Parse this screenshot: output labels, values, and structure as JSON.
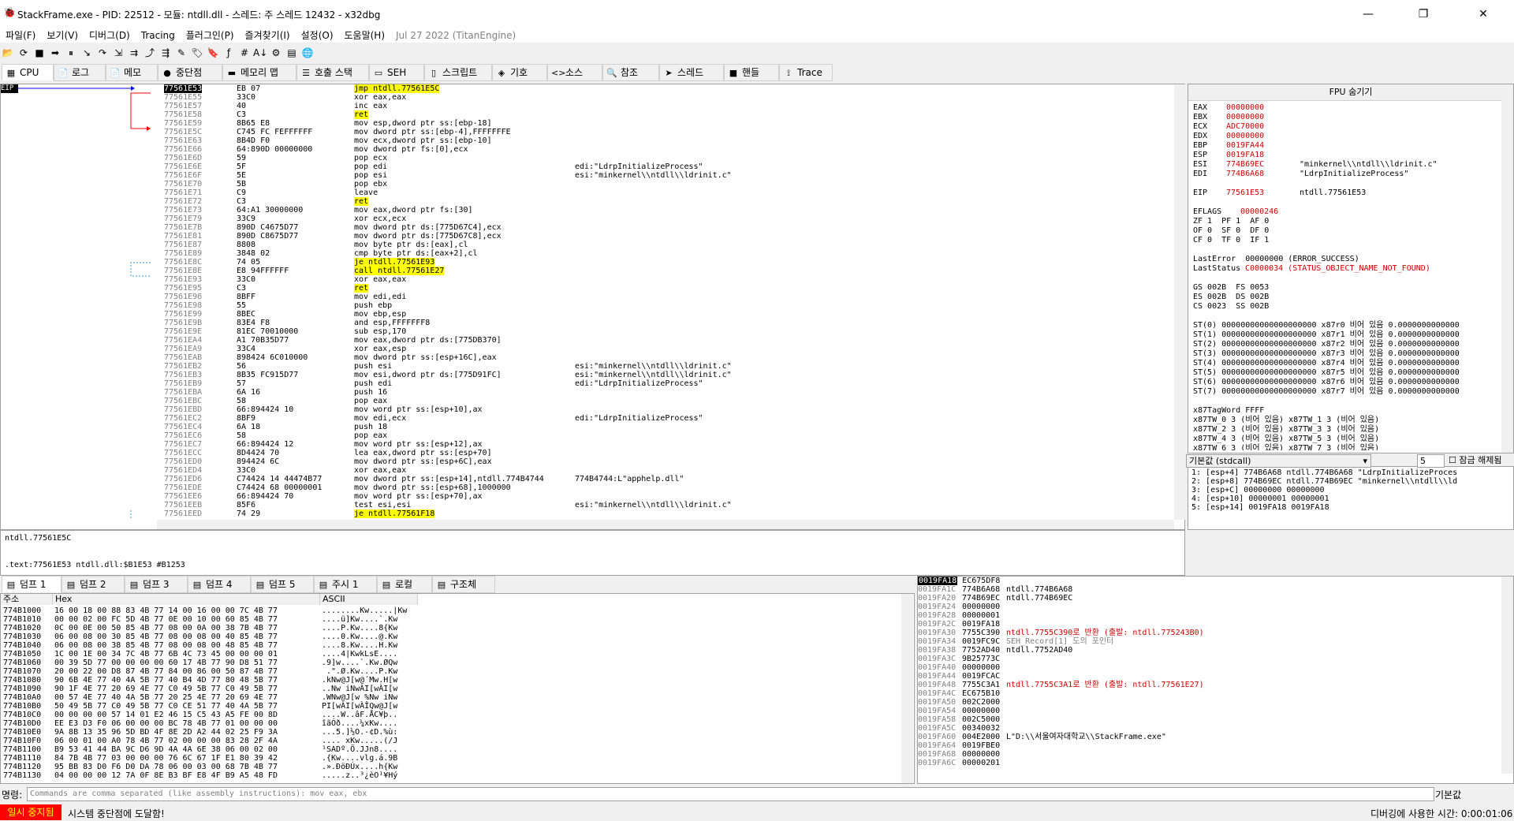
{
  "window": {
    "title": "StackFrame.exe - PID: 22512 - 모듈: ntdll.dll - 스레드: 주 스레드 12432 - x32dbg",
    "minimize": "—",
    "maximize": "❐",
    "close": "✕"
  },
  "menu": [
    "파일(F)",
    "보기(V)",
    "디버그(D)",
    "Tracing",
    "플러그인(P)",
    "즐겨찾기(I)",
    "설정(O)",
    "도움말(H)"
  ],
  "build_date": "Jul 27 2022 (TitanEngine)",
  "toolbar_icons": [
    "open-icon",
    "restart-icon",
    "stop-icon",
    "run-icon",
    "pause-icon",
    "step-into-icon",
    "step-over-icon",
    "trace-into-icon",
    "trace-over-icon",
    "execute-till-return-icon",
    "run-to-user-code-icon",
    "comment-icon",
    "label-icon",
    "bookmark-icon",
    "function-icon",
    "hash-icon",
    "font-icon",
    "patch-icon",
    "calculator-icon",
    "globe-icon"
  ],
  "toolbar_glyphs": [
    "📂",
    "⟳",
    "■",
    "➡",
    "⏸",
    "↘",
    "↷",
    "⇲",
    "⇉",
    "⤴",
    "⇶",
    "✎",
    "🏷",
    "🔖",
    "ƒ",
    "#",
    "A↓",
    "⚙",
    "▤",
    "🌐"
  ],
  "tabs": [
    {
      "label": "CPU",
      "icon": "cpu-icon",
      "glyph": "▦",
      "active": true
    },
    {
      "label": "로그",
      "icon": "log-icon",
      "glyph": "📄"
    },
    {
      "label": "메모",
      "icon": "notes-icon",
      "glyph": "📄"
    },
    {
      "label": "중단점",
      "icon": "breakpoint-icon",
      "glyph": "●"
    },
    {
      "label": "메모리 맵",
      "icon": "memory-map-icon",
      "glyph": "▬"
    },
    {
      "label": "호출 스택",
      "icon": "call-stack-icon",
      "glyph": "☰"
    },
    {
      "label": "SEH",
      "icon": "seh-icon",
      "glyph": "▭"
    },
    {
      "label": "스크립트",
      "icon": "script-icon",
      "glyph": "▯"
    },
    {
      "label": "기호",
      "icon": "symbols-icon",
      "glyph": "◈"
    },
    {
      "label": "소스",
      "icon": "source-icon",
      "glyph": "<>"
    },
    {
      "label": "참조",
      "icon": "references-icon",
      "glyph": "🔍"
    },
    {
      "label": "스레드",
      "icon": "threads-icon",
      "glyph": "➤"
    },
    {
      "label": "핸들",
      "icon": "handles-icon",
      "glyph": "■"
    },
    {
      "label": "Trace",
      "icon": "trace-icon",
      "glyph": "⟟"
    }
  ],
  "eip_label": "EIP",
  "disasm": [
    {
      "addr": "77561E53",
      "bytes": "EB 07",
      "ins": "jmp ntdll.77561E5C",
      "cmt": "",
      "hl": "sel"
    },
    {
      "addr": "77561E55",
      "bytes": "33C0",
      "ins": "xor eax,eax",
      "cmt": ""
    },
    {
      "addr": "77561E57",
      "bytes": "40",
      "ins": "inc eax",
      "cmt": ""
    },
    {
      "addr": "77561E58",
      "bytes": "C3",
      "ins": "ret",
      "cmt": "",
      "hl": "y"
    },
    {
      "addr": "77561E59",
      "bytes": "8B65 E8",
      "ins": "mov esp,dword ptr ss:[ebp-18]",
      "cmt": ""
    },
    {
      "addr": "77561E5C",
      "bytes": "C745 FC FEFFFFFF",
      "ins": "mov dword ptr ss:[ebp-4],FFFFFFFE",
      "cmt": ""
    },
    {
      "addr": "77561E63",
      "bytes": "8B4D F0",
      "ins": "mov ecx,dword ptr ss:[ebp-10]",
      "cmt": ""
    },
    {
      "addr": "77561E66",
      "bytes": "64:890D 00000000",
      "ins": "mov dword ptr fs:[0],ecx",
      "cmt": ""
    },
    {
      "addr": "77561E6D",
      "bytes": "59",
      "ins": "pop ecx",
      "cmt": ""
    },
    {
      "addr": "77561E6E",
      "bytes": "5F",
      "ins": "pop edi",
      "cmt": "edi:\"LdrpInitializeProcess\""
    },
    {
      "addr": "77561E6F",
      "bytes": "5E",
      "ins": "pop esi",
      "cmt": "esi:\"minkernel\\\\ntdll\\\\ldrinit.c\""
    },
    {
      "addr": "77561E70",
      "bytes": "5B",
      "ins": "pop ebx",
      "cmt": ""
    },
    {
      "addr": "77561E71",
      "bytes": "C9",
      "ins": "leave",
      "cmt": ""
    },
    {
      "addr": "77561E72",
      "bytes": "C3",
      "ins": "ret",
      "cmt": "",
      "hl": "y"
    },
    {
      "addr": "77561E73",
      "bytes": "64:A1 30000000",
      "ins": "mov eax,dword ptr fs:[30]",
      "cmt": ""
    },
    {
      "addr": "77561E79",
      "bytes": "33C9",
      "ins": "xor ecx,ecx",
      "cmt": ""
    },
    {
      "addr": "77561E7B",
      "bytes": "890D C4675D77",
      "ins": "mov dword ptr ds:[775D67C4],ecx",
      "cmt": ""
    },
    {
      "addr": "77561E81",
      "bytes": "890D C8675D77",
      "ins": "mov dword ptr ds:[775D67C8],ecx",
      "cmt": ""
    },
    {
      "addr": "77561E87",
      "bytes": "8808",
      "ins": "mov byte ptr ds:[eax],cl",
      "cmt": ""
    },
    {
      "addr": "77561E89",
      "bytes": "3848 02",
      "ins": "cmp byte ptr ds:[eax+2],cl",
      "cmt": ""
    },
    {
      "addr": "77561E8C",
      "bytes": "74 05",
      "ins": "je ntdll.77561E93",
      "cmt": "",
      "hl": "y"
    },
    {
      "addr": "77561E8E",
      "bytes": "E8 94FFFFFF",
      "ins": "call ntdll.77561E27",
      "cmt": "",
      "hl": "y"
    },
    {
      "addr": "77561E93",
      "bytes": "33C0",
      "ins": "xor eax,eax",
      "cmt": ""
    },
    {
      "addr": "77561E95",
      "bytes": "C3",
      "ins": "ret",
      "cmt": "",
      "hl": "y"
    },
    {
      "addr": "77561E96",
      "bytes": "8BFF",
      "ins": "mov edi,edi",
      "cmt": ""
    },
    {
      "addr": "77561E98",
      "bytes": "55",
      "ins": "push ebp",
      "cmt": ""
    },
    {
      "addr": "77561E99",
      "bytes": "8BEC",
      "ins": "mov ebp,esp",
      "cmt": ""
    },
    {
      "addr": "77561E9B",
      "bytes": "83E4 F8",
      "ins": "and esp,FFFFFFF8",
      "cmt": ""
    },
    {
      "addr": "77561E9E",
      "bytes": "81EC 70010000",
      "ins": "sub esp,170",
      "cmt": ""
    },
    {
      "addr": "77561EA4",
      "bytes": "A1 70B35D77",
      "ins": "mov eax,dword ptr ds:[775DB370]",
      "cmt": ""
    },
    {
      "addr": "77561EA9",
      "bytes": "33C4",
      "ins": "xor eax,esp",
      "cmt": ""
    },
    {
      "addr": "77561EAB",
      "bytes": "898424 6C010000",
      "ins": "mov dword ptr ss:[esp+16C],eax",
      "cmt": ""
    },
    {
      "addr": "77561EB2",
      "bytes": "56",
      "ins": "push esi",
      "cmt": "esi:\"minkernel\\\\ntdll\\\\ldrinit.c\""
    },
    {
      "addr": "77561EB3",
      "bytes": "8B35 FC915D77",
      "ins": "mov esi,dword ptr ds:[775D91FC]",
      "cmt": "esi:\"minkernel\\\\ntdll\\\\ldrinit.c\""
    },
    {
      "addr": "77561EB9",
      "bytes": "57",
      "ins": "push edi",
      "cmt": "edi:\"LdrpInitializeProcess\""
    },
    {
      "addr": "77561EBA",
      "bytes": "6A 16",
      "ins": "push 16",
      "cmt": ""
    },
    {
      "addr": "77561EBC",
      "bytes": "58",
      "ins": "pop eax",
      "cmt": ""
    },
    {
      "addr": "77561EBD",
      "bytes": "66:894424 10",
      "ins": "mov word ptr ss:[esp+10],ax",
      "cmt": ""
    },
    {
      "addr": "77561EC2",
      "bytes": "8BF9",
      "ins": "mov edi,ecx",
      "cmt": "edi:\"LdrpInitializeProcess\""
    },
    {
      "addr": "77561EC4",
      "bytes": "6A 18",
      "ins": "push 18",
      "cmt": ""
    },
    {
      "addr": "77561EC6",
      "bytes": "58",
      "ins": "pop eax",
      "cmt": ""
    },
    {
      "addr": "77561EC7",
      "bytes": "66:894424 12",
      "ins": "mov word ptr ss:[esp+12],ax",
      "cmt": ""
    },
    {
      "addr": "77561ECC",
      "bytes": "8D4424 70",
      "ins": "lea eax,dword ptr ss:[esp+70]",
      "cmt": ""
    },
    {
      "addr": "77561ED0",
      "bytes": "894424 6C",
      "ins": "mov dword ptr ss:[esp+6C],eax",
      "cmt": ""
    },
    {
      "addr": "77561ED4",
      "bytes": "33C0",
      "ins": "xor eax,eax",
      "cmt": ""
    },
    {
      "addr": "77561ED6",
      "bytes": "C74424 14 44474B77",
      "ins": "mov dword ptr ss:[esp+14],ntdll.774B4744",
      "cmt": "774B4744:L\"apphelp.dll\""
    },
    {
      "addr": "77561EDE",
      "bytes": "C74424 68 00000001",
      "ins": "mov dword ptr ss:[esp+68],1000000",
      "cmt": ""
    },
    {
      "addr": "77561EE6",
      "bytes": "66:894424 70",
      "ins": "mov word ptr ss:[esp+70],ax",
      "cmt": ""
    },
    {
      "addr": "77561EEB",
      "bytes": "85F6",
      "ins": "test esi,esi",
      "cmt": "esi:\"minkernel\\\\ntdll\\\\ldrinit.c\""
    },
    {
      "addr": "77561EED",
      "bytes": "74 29",
      "ins": "je ntdll.77561F18",
      "cmt": "",
      "hl": "y"
    }
  ],
  "info": {
    "line1": "ntdll.77561E5C",
    "line2": ".text:77561E53 ntdll.dll:$B1E53 #B1253"
  },
  "fpu": {
    "header": "FPU 숨기기",
    "regs": [
      {
        "n": "EAX",
        "v": "00000000",
        "c": ""
      },
      {
        "n": "EBX",
        "v": "00000000",
        "c": ""
      },
      {
        "n": "ECX",
        "v": "ADC70000",
        "c": ""
      },
      {
        "n": "EDX",
        "v": "00000000",
        "c": ""
      },
      {
        "n": "EBP",
        "v": "0019FA44",
        "c": ""
      },
      {
        "n": "ESP",
        "v": "0019FA18",
        "c": ""
      },
      {
        "n": "ESI",
        "v": "774B69EC",
        "c": "\"minkernel\\\\ntdll\\\\ldrinit.c\""
      },
      {
        "n": "EDI",
        "v": "774B6A68",
        "c": "\"LdrpInitializeProcess\""
      }
    ],
    "eip": {
      "n": "EIP",
      "v": "77561E53",
      "c": "ntdll.77561E53"
    },
    "eflags": {
      "n": "EFLAGS",
      "v": "00000246"
    },
    "flags": [
      "ZF 1  PF 1  AF 0",
      "OF 0  SF 0  DF 0",
      "CF 0  TF 0  IF 1"
    ],
    "lasterror": "LastError  00000000 (ERROR_SUCCESS)",
    "laststatus_label": "LastStatus",
    "laststatus_value": "C0000034 (STATUS_OBJECT_NAME_NOT_FOUND)",
    "segs": [
      "GS 002B  FS 0053",
      "ES 002B  DS 002B",
      "CS 0023  SS 002B"
    ],
    "st": [
      "ST(0) 00000000000000000000 x87r0 비어 있음 0.0000000000000",
      "ST(1) 00000000000000000000 x87r1 비어 있음 0.0000000000000",
      "ST(2) 00000000000000000000 x87r2 비어 있음 0.0000000000000",
      "ST(3) 00000000000000000000 x87r3 비어 있음 0.0000000000000",
      "ST(4) 00000000000000000000 x87r4 비어 있음 0.0000000000000",
      "ST(5) 00000000000000000000 x87r5 비어 있음 0.0000000000000",
      "ST(6) 00000000000000000000 x87r6 비어 있음 0.0000000000000",
      "ST(7) 00000000000000000000 x87r7 비어 있음 0.0000000000000"
    ],
    "tag": [
      "x87TagWord FFFF",
      "x87TW_0 3 (비어 있음) x87TW_1 3 (비어 있음)",
      "x87TW_2 3 (비어 있음) x87TW_3 3 (비어 있음)",
      "x87TW_4 3 (비어 있음) x87TW_5 3 (비어 있음)",
      "x87TW_6 3 (비어 있음) x87TW_7 3 (비어 있음)"
    ]
  },
  "callconv": {
    "select": "기본값 (stdcall)",
    "count": "5",
    "lock_label": "잠금 해제됨",
    "rows": [
      "1: [esp+4] 774B6A68 ntdll.774B6A68 \"LdrpInitializeProces",
      "2: [esp+8] 774B69EC ntdll.774B69EC \"minkernel\\\\ntdll\\\\ld",
      "3: [esp+C] 00000000 00000000",
      "4: [esp+10] 00000001 00000001",
      "5: [esp+14] 0019FA18 0019FA18"
    ]
  },
  "dump_tabs": [
    {
      "label": "덤프 1",
      "icon": "dump-icon",
      "active": true
    },
    {
      "label": "덤프 2",
      "icon": "dump-icon"
    },
    {
      "label": "덤프 3",
      "icon": "dump-icon"
    },
    {
      "label": "덤프 4",
      "icon": "dump-icon"
    },
    {
      "label": "덤프 5",
      "icon": "dump-icon"
    },
    {
      "label": "주시 1",
      "icon": "watch-icon"
    },
    {
      "label": "로컬",
      "icon": "locals-icon"
    },
    {
      "label": "구조체",
      "icon": "struct-icon"
    }
  ],
  "dump_headers": {
    "addr": "주소",
    "hex": "Hex",
    "ascii": "ASCII"
  },
  "dump": [
    {
      "a": "774B1000",
      "h": "16 00 18 00 88 83 4B 77 14 00 16 00 00 7C 4B 77",
      "s": "........Kw.....|Kw"
    },
    {
      "a": "774B1010",
      "h": "00 00 02 00 FC 5D 4B 77 0E 00 10 00 60 85 4B 77",
      "s": "....ü]Kw....`.Kw"
    },
    {
      "a": "774B1020",
      "h": "0C 00 0E 00 50 85 4B 77 08 00 0A 00 38 7B 4B 77",
      "s": "....P.Kw....8{Kw"
    },
    {
      "a": "774B1030",
      "h": "06 00 08 00 30 85 4B 77 08 00 08 00 40 85 4B 77",
      "s": "....0.Kw....@.Kw"
    },
    {
      "a": "774B1040",
      "h": "06 00 08 00 38 85 4B 77 08 00 08 00 48 85 4B 77",
      "s": "....8.Kw....H.Kw"
    },
    {
      "a": "774B1050",
      "h": "1C 00 1E 00 34 7C 4B 77 6B 4C 73 45 00 00 00 01",
      "s": "....4|KwkLsE...."
    },
    {
      "a": "774B1060",
      "h": "00 39 5D 77 00 00 00 00 60 17 4B 77 90 D8 51 77",
      "s": ".9]w....`.Kw.ØQw"
    },
    {
      "a": "774B1070",
      "h": "20 00 22 00 D8 87 4B 77 84 00 86 00 50 87 4B 77",
      "s": " .\".Ø.Kw....P.Kw"
    },
    {
      "a": "774B1080",
      "h": "90 6B 4E 77 40 4A 5B 77 40 B4 4D 77 80 48 5B 77",
      "s": ".kNw@J[w@´Mw.H[w"
    },
    {
      "a": "774B1090",
      "h": "90 1F 4E 77 20 69 4E 77 C0 49 5B 77 C0 49 5B 77",
      "s": "..Nw iNwÀI[wÀI[w"
    },
    {
      "a": "774B10A0",
      "h": "00 57 4E 77 40 4A 5B 77 20 25 4E 77 20 69 4E 77",
      "s": ".WNw@J[w %Nw iNw"
    },
    {
      "a": "774B10B0",
      "h": "50 49 5B 77 C0 49 5B 77 C0 CE 51 77 40 4A 5B 77",
      "s": "PI[wÀI[wÀÎQw@J[w"
    },
    {
      "a": "774B10C0",
      "h": "00 00 00 00 57 14 01 E2 46 15 C5 43 A5 FE 00 8D",
      "s": "....W..âF.ÅC¥þ.."
    },
    {
      "a": "774B10D0",
      "h": "EE E3 D3 F0 06 00 00 00 BC 78 4B 77 01 00 00 00",
      "s": "îãÓð....¼xKw...."
    },
    {
      "a": "774B10E0",
      "h": "9A 8B 13 35 96 5D BD 4F 8E 2D A2 44 02 25 F9 3A",
      "s": "...5.]½O.-¢D.%ù:"
    },
    {
      "a": "774B10F0",
      "h": "06 00 01 00 A0 78 4B 77 02 00 00 00 83 28 2F 4A",
      "s": ".... xKw.....(/J"
    },
    {
      "a": "774B1100",
      "h": "B9 53 41 44 BA 9C D6 9D 4A 4A 6E 38 06 00 02 00",
      "s": "¹SADº.Ö.JJn8...."
    },
    {
      "a": "774B1110",
      "h": "84 7B 4B 77 03 00 00 00 76 6C 67 1F E1 80 39 42",
      "s": ".{Kw....vlg.á.9B"
    },
    {
      "a": "774B1120",
      "h": "95 BB 83 D0 F6 D0 DA 78 06 00 03 00 68 7B 4B 77",
      "s": ".».ÐöÐÚx....h{Kw"
    },
    {
      "a": "774B1130",
      "h": "04 00 00 00 12 7A 0F 8E B3 BF E8 4F B9 A5 48 FD",
      "s": ".....z..³¿èO¹¥Hý"
    }
  ],
  "stack": {
    "header_addr": "0019FA18",
    "header_val": "EC675DF8",
    "rows": [
      {
        "a": "0019FA1C",
        "v": "774B6A68",
        "c": "ntdll.774B6A68",
        "cls": ""
      },
      {
        "a": "0019FA20",
        "v": "774B69EC",
        "c": "ntdll.774B69EC",
        "cls": ""
      },
      {
        "a": "0019FA24",
        "v": "00000000",
        "c": "",
        "cls": ""
      },
      {
        "a": "0019FA28",
        "v": "00000001",
        "c": "",
        "cls": ""
      },
      {
        "a": "0019FA2C",
        "v": "0019FA18",
        "c": "",
        "cls": ""
      },
      {
        "a": "0019FA30",
        "v": "7755C390",
        "c": "ntdll.7755C390로 반환 (출발: ntdll.775243B0)",
        "cls": "red"
      },
      {
        "a": "0019FA34",
        "v": "0019FC9C",
        "c": "SEH_Record[1] 도의 포인터",
        "cls": "gray"
      },
      {
        "a": "0019FA38",
        "v": "7752AD40",
        "c": "ntdll.7752AD40",
        "cls": ""
      },
      {
        "a": "0019FA3C",
        "v": "9B25773C",
        "c": "",
        "cls": ""
      },
      {
        "a": "0019FA40",
        "v": "00000000",
        "c": "",
        "cls": ""
      },
      {
        "a": "0019FA44",
        "v": "0019FCAC",
        "c": "",
        "cls": ""
      },
      {
        "a": "0019FA48",
        "v": "7755C3A1",
        "c": "ntdll.7755C3A1로 반환 (출발: ntdll.77561E27)",
        "cls": "red"
      },
      {
        "a": "0019FA4C",
        "v": "EC675B10",
        "c": "",
        "cls": ""
      },
      {
        "a": "0019FA50",
        "v": "002C2000",
        "c": "",
        "cls": ""
      },
      {
        "a": "0019FA54",
        "v": "00000000",
        "c": "",
        "cls": ""
      },
      {
        "a": "0019FA58",
        "v": "002C5000",
        "c": "",
        "cls": ""
      },
      {
        "a": "0019FA5C",
        "v": "00340032",
        "c": "",
        "cls": ""
      },
      {
        "a": "0019FA60",
        "v": "004E2000",
        "c": "L\"D:\\\\서울여자대학교\\\\StackFrame.exe\"",
        "cls": ""
      },
      {
        "a": "0019FA64",
        "v": "0019FBE0",
        "c": "",
        "cls": ""
      },
      {
        "a": "0019FA68",
        "v": "00000000",
        "c": "",
        "cls": ""
      },
      {
        "a": "0019FA6C",
        "v": "00000201",
        "c": "",
        "cls": ""
      }
    ]
  },
  "command": {
    "label": "명령:",
    "placeholder": "Commands are comma separated (like assembly instructions): mov eax, ebx",
    "default_label": "기본값"
  },
  "status": {
    "state": "일시 중지됨",
    "message": "시스템 중단점에 도달함!",
    "time": "디버깅에 사용한 시간: 0:00:01:06"
  }
}
